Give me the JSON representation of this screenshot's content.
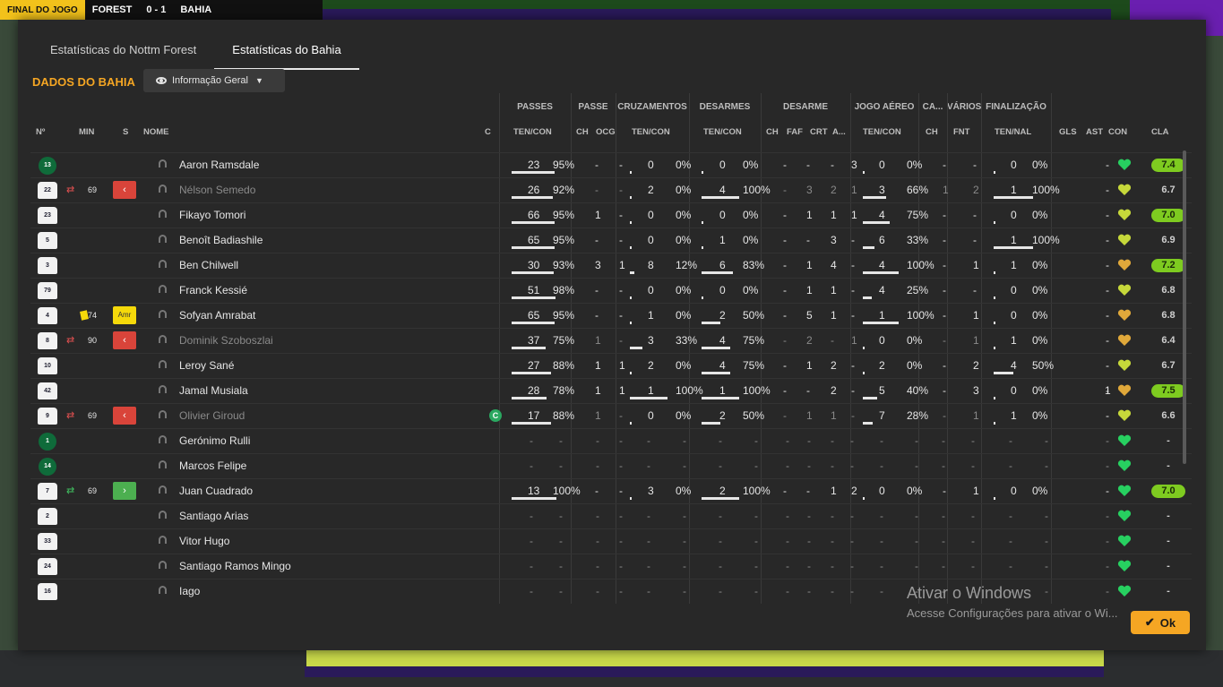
{
  "scoreboard": {
    "status": "FINAL DO JOGO",
    "home": "FOREST",
    "score": "0 - 1",
    "away": "BAHIA"
  },
  "tabs": [
    {
      "label": "Estatísticas do Nottm Forest"
    },
    {
      "label": "Estatísticas do Bahia"
    }
  ],
  "section_title": "DADOS DO BAHIA",
  "view_dropdown": {
    "label": "Informação Geral"
  },
  "group_headers": [
    "PASSES",
    "PASSE",
    "CRUZAMENTOS",
    "DESARMES",
    "DESARME",
    "JOGO AÉREO",
    "CA...",
    "VÁRIOS",
    "FINALIZAÇÃO"
  ],
  "column_headers": {
    "no": "Nº",
    "min": "MIN",
    "s": "S",
    "name": "NOME",
    "c": "C",
    "passes": "TEN/CON",
    "passe_ch": "CH",
    "passe_ocg": "OCG",
    "cruz": "TEN/CON",
    "desarmes": "TEN/CON",
    "des_ch": "CH",
    "des_faf": "FAF",
    "des_crt": "CRT",
    "des_a": "A...",
    "aereo": "TEN/CON",
    "ca_ch": "CH",
    "varios": "FNT",
    "final": "TEN/NAL",
    "gls": "GLS",
    "ast": "AST",
    "con": "CON",
    "cla": "CLA"
  },
  "players": [
    {
      "no": "13",
      "gk": true,
      "name": "Aaron Ramsdale",
      "pass": [
        "23",
        "95%"
      ],
      "passfrac": 0.95,
      "ch": "-",
      "ocg": "-",
      "cruz": [
        "0",
        "0%"
      ],
      "cruzfrac": 0,
      "des": [
        "0",
        "0%"
      ],
      "desfrac": 0,
      "dch": "-",
      "faf": "-",
      "crt": "-",
      "da": "3",
      "aer": [
        "0",
        "0%"
      ],
      "aerfrac": 0,
      "cach": "-",
      "fnt": "-",
      "fin": [
        "0",
        "0%"
      ],
      "finfrac": 0,
      "gls": "",
      "ast": "-",
      "rating": "7.4",
      "good": true,
      "heart": "#27d060"
    },
    {
      "no": "22",
      "sub": "out",
      "min": "69",
      "name": "Nélson Semedo",
      "dim": true,
      "pass": [
        "26",
        "92%"
      ],
      "passfrac": 0.92,
      "ch": "-",
      "ocg": "-",
      "cruz": [
        "2",
        "0%"
      ],
      "cruzfrac": 0,
      "des": [
        "4",
        "100%"
      ],
      "desfrac": 1,
      "dch": "-",
      "faf": "3",
      "crt": "2",
      "da": "1",
      "aer": [
        "3",
        "66%"
      ],
      "aerfrac": 0.66,
      "cach": "1",
      "fnt": "2",
      "fin": [
        "1",
        "100%"
      ],
      "finfrac": 1,
      "gls": "",
      "ast": "-",
      "rating": "6.7",
      "good": false,
      "heart": "#c6d83a"
    },
    {
      "no": "23",
      "name": "Fikayo Tomori",
      "pass": [
        "66",
        "95%"
      ],
      "passfrac": 0.95,
      "ch": "1",
      "ocg": "-",
      "cruz": [
        "0",
        "0%"
      ],
      "cruzfrac": 0,
      "des": [
        "0",
        "0%"
      ],
      "desfrac": 0,
      "dch": "-",
      "faf": "1",
      "crt": "1",
      "da": "1",
      "aer": [
        "4",
        "75%"
      ],
      "aerfrac": 0.75,
      "cach": "-",
      "fnt": "-",
      "fin": [
        "0",
        "0%"
      ],
      "finfrac": 0,
      "gls": "",
      "ast": "-",
      "rating": "7.0",
      "good": true,
      "heart": "#c6d83a"
    },
    {
      "no": "5",
      "name": "Benoît Badiashile",
      "pass": [
        "65",
        "95%"
      ],
      "passfrac": 0.95,
      "ch": "-",
      "ocg": "-",
      "cruz": [
        "0",
        "0%"
      ],
      "cruzfrac": 0,
      "des": [
        "1",
        "0%"
      ],
      "desfrac": 0,
      "dch": "-",
      "faf": "-",
      "crt": "3",
      "da": "-",
      "aer": [
        "6",
        "33%"
      ],
      "aerfrac": 0.33,
      "cach": "-",
      "fnt": "-",
      "fin": [
        "1",
        "100%"
      ],
      "finfrac": 1,
      "gls": "",
      "ast": "-",
      "rating": "6.9",
      "good": false,
      "heart": "#c6d83a"
    },
    {
      "no": "3",
      "name": "Ben Chilwell",
      "pass": [
        "30",
        "93%"
      ],
      "passfrac": 0.93,
      "ch": "3",
      "ocg": "1",
      "cruz": [
        "8",
        "12%"
      ],
      "cruzfrac": 0.12,
      "des": [
        "6",
        "83%"
      ],
      "desfrac": 0.83,
      "dch": "-",
      "faf": "1",
      "crt": "4",
      "da": "-",
      "aer": [
        "4",
        "100%"
      ],
      "aerfrac": 1,
      "cach": "-",
      "fnt": "1",
      "fin": [
        "1",
        "0%"
      ],
      "finfrac": 0,
      "gls": "",
      "ast": "-",
      "rating": "7.2",
      "good": true,
      "heart": "#e0a83a"
    },
    {
      "no": "79",
      "name": "Franck Kessié",
      "pass": [
        "51",
        "98%"
      ],
      "passfrac": 0.98,
      "ch": "-",
      "ocg": "-",
      "cruz": [
        "0",
        "0%"
      ],
      "cruzfrac": 0,
      "des": [
        "0",
        "0%"
      ],
      "desfrac": 0,
      "dch": "-",
      "faf": "1",
      "crt": "1",
      "da": "-",
      "aer": [
        "4",
        "25%"
      ],
      "aerfrac": 0.25,
      "cach": "-",
      "fnt": "-",
      "fin": [
        "0",
        "0%"
      ],
      "finfrac": 0,
      "gls": "",
      "ast": "-",
      "rating": "6.8",
      "good": false,
      "heart": "#c6d83a"
    },
    {
      "no": "4",
      "card": true,
      "min": "74",
      "sbadge": "Amr",
      "name": "Sofyan Amrabat",
      "pass": [
        "65",
        "95%"
      ],
      "passfrac": 0.95,
      "ch": "-",
      "ocg": "-",
      "cruz": [
        "1",
        "0%"
      ],
      "cruzfrac": 0,
      "des": [
        "2",
        "50%"
      ],
      "desfrac": 0.5,
      "dch": "-",
      "faf": "5",
      "crt": "1",
      "da": "-",
      "aer": [
        "1",
        "100%"
      ],
      "aerfrac": 1,
      "cach": "-",
      "fnt": "1",
      "fin": [
        "0",
        "0%"
      ],
      "finfrac": 0,
      "gls": "",
      "ast": "-",
      "rating": "6.8",
      "good": false,
      "heart": "#e0a83a"
    },
    {
      "no": "8",
      "sub": "out",
      "min": "90",
      "name": "Dominik Szoboszlai",
      "dim": true,
      "pass": [
        "37",
        "75%"
      ],
      "passfrac": 0.75,
      "ch": "1",
      "ocg": "-",
      "cruz": [
        "3",
        "33%"
      ],
      "cruzfrac": 0.33,
      "des": [
        "4",
        "75%"
      ],
      "desfrac": 0.75,
      "dch": "-",
      "faf": "2",
      "crt": "-",
      "da": "1",
      "aer": [
        "0",
        "0%"
      ],
      "aerfrac": 0,
      "cach": "-",
      "fnt": "1",
      "fin": [
        "1",
        "0%"
      ],
      "finfrac": 0,
      "gls": "",
      "ast": "-",
      "rating": "6.4",
      "good": false,
      "heart": "#e0a83a"
    },
    {
      "no": "10",
      "name": "Leroy Sané",
      "pass": [
        "27",
        "88%"
      ],
      "passfrac": 0.88,
      "ch": "1",
      "ocg": "1",
      "cruz": [
        "2",
        "0%"
      ],
      "cruzfrac": 0,
      "des": [
        "4",
        "75%"
      ],
      "desfrac": 0.75,
      "dch": "-",
      "faf": "1",
      "crt": "2",
      "da": "-",
      "aer": [
        "2",
        "0%"
      ],
      "aerfrac": 0,
      "cach": "-",
      "fnt": "2",
      "fin": [
        "4",
        "50%"
      ],
      "finfrac": 0.5,
      "gls": "",
      "ast": "-",
      "rating": "6.7",
      "good": false,
      "heart": "#c6d83a"
    },
    {
      "no": "42",
      "name": "Jamal Musiala",
      "pass": [
        "28",
        "78%"
      ],
      "passfrac": 0.78,
      "ch": "1",
      "ocg": "1",
      "cruz": [
        "1",
        "100%"
      ],
      "cruzfrac": 1,
      "des": [
        "1",
        "100%"
      ],
      "desfrac": 1,
      "dch": "-",
      "faf": "-",
      "crt": "2",
      "da": "-",
      "aer": [
        "5",
        "40%"
      ],
      "aerfrac": 0.4,
      "cach": "-",
      "fnt": "3",
      "fin": [
        "0",
        "0%"
      ],
      "finfrac": 0,
      "gls": "1",
      "ast": "-",
      "rating": "7.5",
      "good": true,
      "heart": "#e0a83a"
    },
    {
      "no": "9",
      "sub": "out",
      "min": "69",
      "name": "Olivier Giroud",
      "dim": true,
      "cap": "C",
      "pass": [
        "17",
        "88%"
      ],
      "passfrac": 0.88,
      "ch": "1",
      "ocg": "-",
      "cruz": [
        "0",
        "0%"
      ],
      "cruzfrac": 0,
      "des": [
        "2",
        "50%"
      ],
      "desfrac": 0.5,
      "dch": "-",
      "faf": "1",
      "crt": "1",
      "da": "-",
      "aer": [
        "7",
        "28%"
      ],
      "aerfrac": 0.28,
      "cach": "-",
      "fnt": "1",
      "fin": [
        "1",
        "0%"
      ],
      "finfrac": 0,
      "gls": "",
      "ast": "-",
      "rating": "6.6",
      "good": false,
      "heart": "#c6d83a"
    },
    {
      "no": "1",
      "gk": true,
      "unused": true,
      "name": "Gerónimo Rulli",
      "rating": "-",
      "heart": "#27d060"
    },
    {
      "no": "14",
      "gk": true,
      "unused": true,
      "name": "Marcos Felipe",
      "rating": "-",
      "heart": "#27d060"
    },
    {
      "no": "7",
      "sub": "in",
      "min": "69",
      "name": "Juan Cuadrado",
      "pass": [
        "13",
        "100%"
      ],
      "passfrac": 1,
      "ch": "-",
      "ocg": "-",
      "cruz": [
        "3",
        "0%"
      ],
      "cruzfrac": 0,
      "des": [
        "2",
        "100%"
      ],
      "desfrac": 1,
      "dch": "-",
      "faf": "-",
      "crt": "1",
      "da": "2",
      "aer": [
        "0",
        "0%"
      ],
      "aerfrac": 0,
      "cach": "-",
      "fnt": "1",
      "fin": [
        "0",
        "0%"
      ],
      "finfrac": 0,
      "gls": "",
      "ast": "-",
      "rating": "7.0",
      "good": true,
      "heart": "#27d060"
    },
    {
      "no": "2",
      "unused": true,
      "name": "Santiago Arias",
      "rating": "-",
      "heart": "#27d060"
    },
    {
      "no": "33",
      "unused": true,
      "name": "Vitor Hugo",
      "rating": "-",
      "heart": "#27d060"
    },
    {
      "no": "24",
      "unused": true,
      "name": "Santiago Ramos Mingo",
      "rating": "-",
      "heart": "#27d060"
    },
    {
      "no": "16",
      "unused": true,
      "name": "Iago",
      "rating": "-",
      "heart": "#27d060"
    }
  ],
  "watermark": {
    "line1": "Ativar o Windows",
    "line2": "Acesse Configurações para ativar o Wi..."
  },
  "ok_label": "Ok"
}
